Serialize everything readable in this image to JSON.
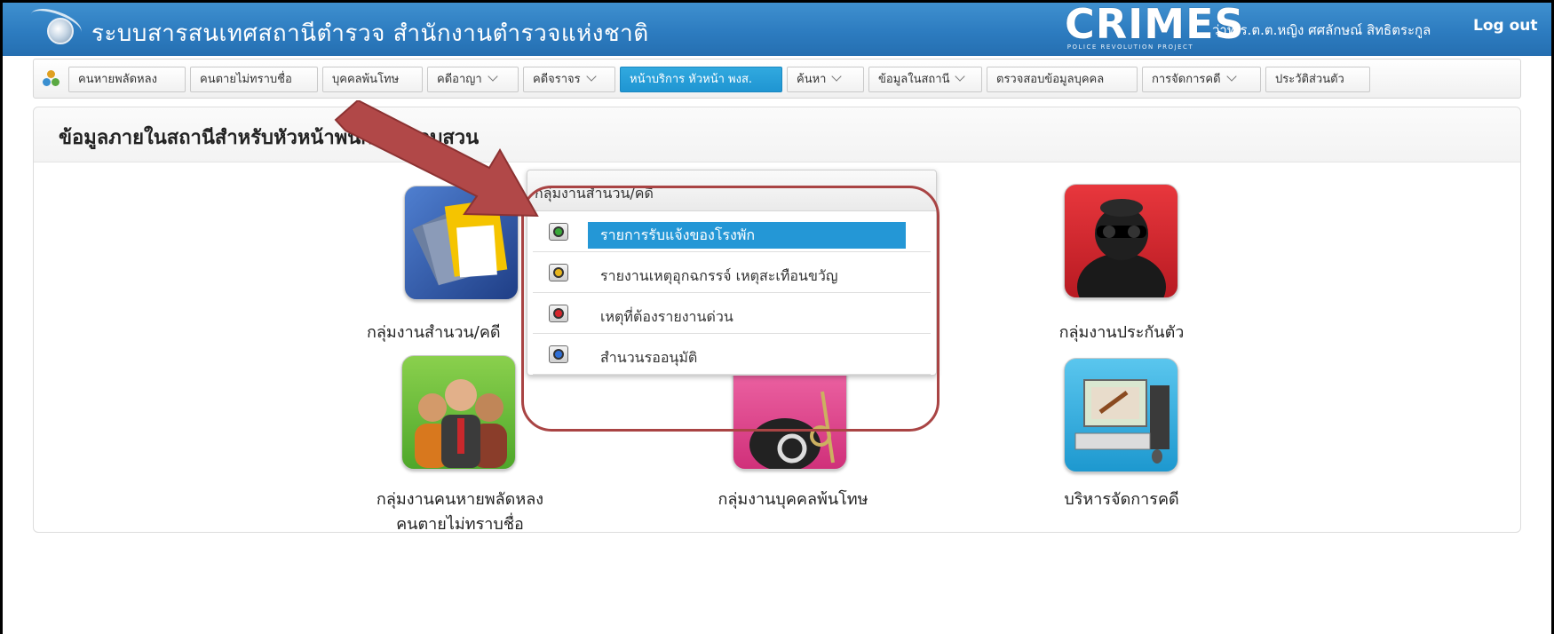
{
  "header": {
    "app_title": "ระบบสารสนเทศสถานีตำรวจ สำนักงานตำรวจแห่งชาติ",
    "brand": "CRIMES",
    "brand_sub": "POLICE REVOLUTION PROJECT",
    "user": "ว่าที่ ร.ต.ต.หญิง ศศลักษณ์ สิทธิตระกูล",
    "logout": "Log out",
    "color": "#2d7cc0"
  },
  "menu": {
    "items": [
      {
        "label": "คนหายพลัดหลง"
      },
      {
        "label": "คนตายไม่ทราบชื่อ"
      },
      {
        "label": "บุคคลพ้นโทษ"
      },
      {
        "label": "คดีอาญา"
      },
      {
        "label": "คดีจราจร"
      },
      {
        "label": "หน้าบริการ หัวหน้า พงส."
      },
      {
        "label": "ค้นหา"
      },
      {
        "label": "ข้อมูลในสถานี"
      },
      {
        "label": "ตรวจสอบข้อมูลบุคคล"
      },
      {
        "label": "การจัดการคดี"
      },
      {
        "label": "ประวัติส่วนตัว"
      }
    ],
    "active_color": "#2497d6"
  },
  "panel": {
    "title": "ข้อมูลภายในสถานีสำหรับหัวหน้าพนักงานสอบสวน"
  },
  "tiles": [
    {
      "label": "กลุ่มงานสำนวน/คดี",
      "icon": "case-files-icon",
      "color": "#2f5ba8"
    },
    {
      "label": "กลุ่มงานประกันตัว",
      "icon": "masked-man-icon",
      "color": "#d42a32"
    },
    {
      "label": "กลุ่มงานคนหายพลัดหลง",
      "label2": "คนตายไม่ทราบชื่อ",
      "icon": "people-group-icon",
      "color": "#6cbf3a"
    },
    {
      "label": "กลุ่มงานบุคคลพ้นโทษ",
      "icon": "handcuffs-icon",
      "color": "#e0468e"
    },
    {
      "label": "บริหารจัดการคดี",
      "icon": "computer-court-icon",
      "color": "#27a4d8"
    }
  ],
  "popup": {
    "title": "กลุ่มงานสำนวน/คดี",
    "items": [
      {
        "label": "รายการรับแจ้งของโรงพัก",
        "icon": "green-dot-icon"
      },
      {
        "label": "รายงานเหตุอุกฉกรรจ์ เหตุสะเทือนขวัญ",
        "icon": "yellow-dot-icon"
      },
      {
        "label": "เหตุที่ต้องรายงานด่วน",
        "icon": "red-dot-icon"
      },
      {
        "label": "สำนวนรออนุมัติ",
        "icon": "blue-dot-icon"
      }
    ]
  },
  "annotation_color": "#a94444"
}
